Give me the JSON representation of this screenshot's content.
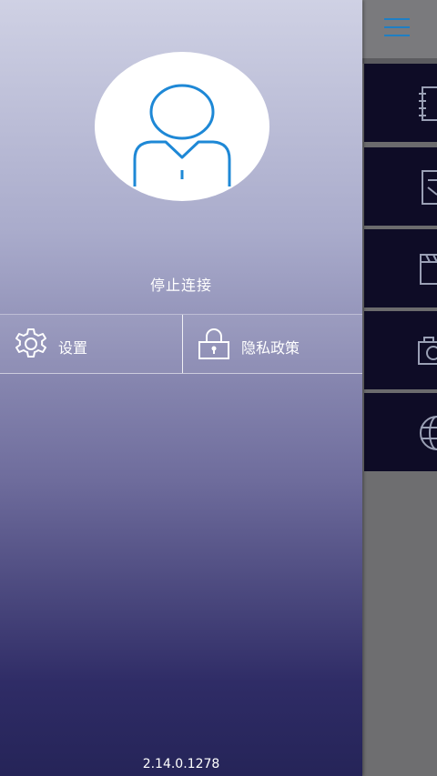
{
  "drawer": {
    "disconnect_label": "停止连接",
    "actions": [
      {
        "label": "设置",
        "icon": "gear-icon"
      },
      {
        "label": "隐私政策",
        "icon": "lock-icon"
      }
    ],
    "version": "2.14.0.1278"
  },
  "background": {
    "tiles": [
      {
        "icon": "notebook-icon"
      },
      {
        "icon": "document-icon"
      },
      {
        "icon": "clapperboard-icon"
      },
      {
        "icon": "camera-icon"
      },
      {
        "icon": "globe-icon"
      }
    ]
  },
  "colors": {
    "avatar_stroke": "#1e88d6",
    "tile_bg": "#0e0c26",
    "drawer_top": "#cfd1e4",
    "drawer_bottom": "#252458"
  }
}
